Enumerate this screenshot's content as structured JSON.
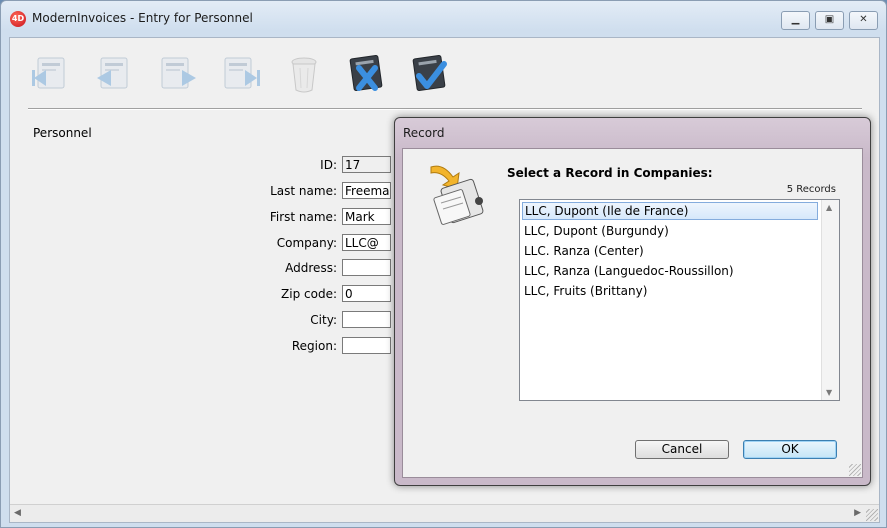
{
  "window": {
    "title": "ModernInvoices - Entry for Personnel",
    "app_icon_text": "4D"
  },
  "toolbar": {
    "tools": [
      "first-record-icon",
      "previous-record-icon",
      "next-record-icon",
      "last-record-icon",
      "delete-record-icon",
      "cancel-icon",
      "accept-icon"
    ]
  },
  "form": {
    "section": "Personnel",
    "fields": [
      {
        "label": "ID:",
        "value": "17"
      },
      {
        "label": "Last name:",
        "value": "Freeman"
      },
      {
        "label": "First name:",
        "value": "Mark"
      },
      {
        "label": "Company:",
        "value": "LLC@"
      },
      {
        "label": "Address:",
        "value": ""
      },
      {
        "label": "Zip code:",
        "value": "0"
      },
      {
        "label": "City:",
        "value": ""
      },
      {
        "label": "Region:",
        "value": ""
      }
    ]
  },
  "dialog": {
    "title": "Record",
    "heading": "Select a Record in Companies:",
    "count": "5 Records",
    "items": [
      "LLC, Dupont  (Ile de France)",
      "LLC, Dupont  (Burgundy)",
      "LLC. Ranza  (Center)",
      "LLC, Ranza  (Languedoc-Roussillon)",
      "LLC, Fruits  (Brittany)"
    ],
    "selected_index": 0,
    "cancel_label": "Cancel",
    "ok_label": "OK"
  }
}
